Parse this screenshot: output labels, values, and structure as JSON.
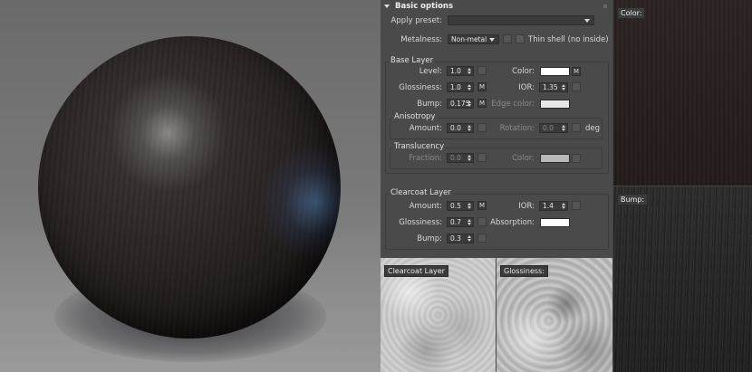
{
  "rollout": {
    "title": "Basic options"
  },
  "apply_preset": {
    "label": "Apply preset:",
    "value": ""
  },
  "metalness": {
    "label": "Metalness:",
    "value": "Non-metal",
    "thin_shell_label": "Thin shell (no inside)"
  },
  "base_layer": {
    "title": "Base Layer",
    "level": {
      "label": "Level:",
      "value": "1.0"
    },
    "color": {
      "label": "Color:",
      "swatch": "#ffffff",
      "map": "M"
    },
    "glossiness": {
      "label": "Glossiness:",
      "value": "1.0",
      "map": "M"
    },
    "ior": {
      "label": "IOR:",
      "value": "1.35"
    },
    "bump": {
      "label": "Bump:",
      "value": "0.175",
      "map": "M"
    },
    "edge_color": {
      "label": "Edge color:",
      "swatch": "#e8e8e8"
    }
  },
  "anisotropy": {
    "title": "Anisotropy",
    "amount": {
      "label": "Amount:",
      "value": "0.0"
    },
    "rotation": {
      "label": "Rotation:",
      "value": "0.0",
      "unit": "deg"
    }
  },
  "translucency": {
    "title": "Translucency",
    "fraction": {
      "label": "Fraction:",
      "value": "0.0"
    },
    "color": {
      "label": "Color:",
      "swatch": "#b8b8b8"
    }
  },
  "clearcoat_layer": {
    "title": "Clearcoat Layer",
    "amount": {
      "label": "Amount:",
      "value": "0.5",
      "map": "M"
    },
    "ior": {
      "label": "IOR:",
      "value": "1.4"
    },
    "glossiness": {
      "label": "Glossiness:",
      "value": "0.7"
    },
    "absorption": {
      "label": "Absorption:",
      "swatch": "#ffffff"
    },
    "bump": {
      "label": "Bump:",
      "value": "0.3"
    }
  },
  "textures": {
    "clearcoat": "Clearcoat Layer",
    "glossiness": "Glossiness:",
    "color": "Color:",
    "bump": "Bump:"
  }
}
